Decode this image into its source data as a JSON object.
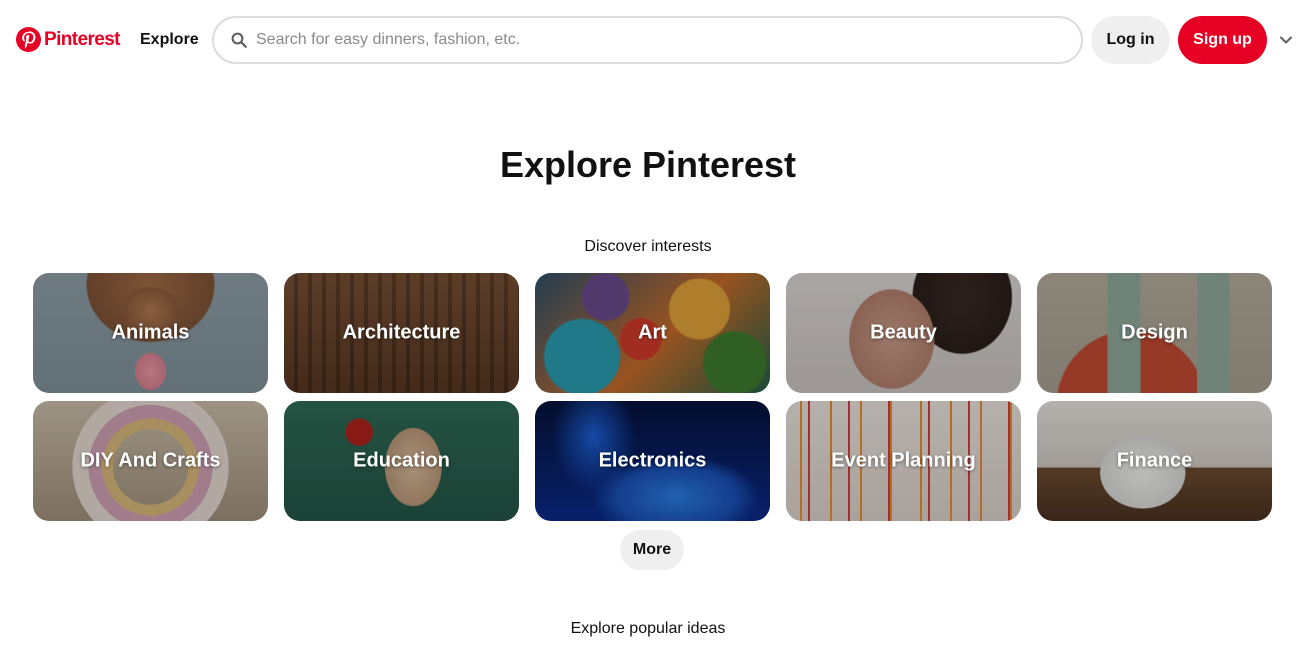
{
  "header": {
    "logo_text": "Pinterest",
    "logo_icon": "pinterest-logo-icon",
    "nav_explore": "Explore",
    "search": {
      "placeholder": "Search for easy dinners, fashion, etc.",
      "value": "",
      "icon": "search-icon"
    },
    "login_label": "Log in",
    "signup_label": "Sign up",
    "menu_icon": "chevron-down-icon"
  },
  "colors": {
    "brand": "#e60023",
    "button_bg": "#efefef"
  },
  "main": {
    "title": "Explore Pinterest",
    "discover_label": "Discover interests",
    "interests": [
      {
        "label": "Animals"
      },
      {
        "label": "Architecture"
      },
      {
        "label": "Art"
      },
      {
        "label": "Beauty"
      },
      {
        "label": "Design"
      },
      {
        "label": "DIY And Crafts"
      },
      {
        "label": "Education"
      },
      {
        "label": "Electronics"
      },
      {
        "label": "Event Planning"
      },
      {
        "label": "Finance"
      }
    ],
    "more_label": "More",
    "popular_label": "Explore popular ideas"
  }
}
